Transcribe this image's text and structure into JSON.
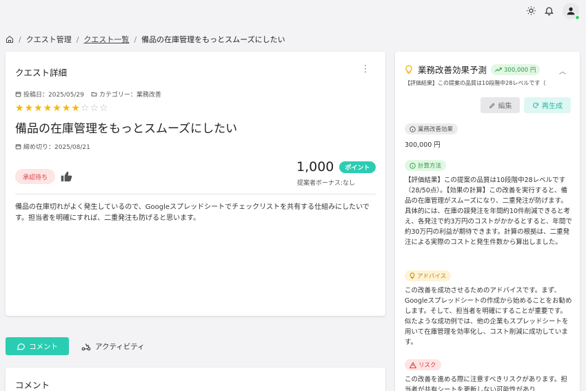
{
  "topbar": {
    "icons": [
      "sun-icon",
      "bell-icon",
      "user-icon"
    ]
  },
  "breadcrumb": {
    "items": [
      "クエスト管理",
      "クエスト一覧",
      "備品の在庫管理をもっとスムーズにしたい"
    ]
  },
  "detail": {
    "card_title": "クエスト詳細",
    "posted_date": "投稿日：2025/05/29",
    "category": "カテゴリー：業務改善",
    "rating": {
      "value": 7,
      "max": 10
    },
    "quest_title": "備品の在庫管理をもっとスムーズにしたい",
    "deadline": "締め切り：2025/08/21",
    "status": "承認待ち",
    "points": "1,000",
    "points_badge": "ポイント",
    "bonus": "提案者ボーナス:なし",
    "description": "備品の在庫切れがよく発生しているので、Googleスプレッドシートでチェックリストを共有する仕組みにしたいです。担当者を明確にすれば、二重発注も防げると思います。"
  },
  "tabs": {
    "comment": "コメント",
    "activity": "アクティビティ"
  },
  "comment_section": {
    "title": "コメント"
  },
  "effect": {
    "title": "業務改善効果予測",
    "amount_badge": "300,000 円",
    "summary": "【評価結果】この提案の品質は10段階中28レベルです（",
    "edit_label": "編集",
    "regen_label": "再生成",
    "effect_chip": "業務改善効果",
    "effect_value": "300,000 円",
    "calc_chip": "計算方法",
    "calc_text": "【評価結果】この提案の品質は10段階中28レベルです（28/50点）。【効果の計算】この改善を実行すると、備品の在庫管理がスムーズになり、二重発注が防げます。具体的には、在庫の誤発注を年間約10件削減できると考え、各発注で約3万円のコストがかかるとすると、年間で約30万円の利益が期待できます。計算の根拠は、二重発注による実際のコストと発生件数から算出しました。",
    "advice_chip": "アドバイス",
    "advice_text": "この改善を成功させるためのアドバイスです。まず、Googleスプレッドシートの作成から始めることをお勧めします。そして、担当者を明確にすることが重要です。似たような成功例では、他の企業もスプレッドシートを用いて在庫管理を効率化し、コスト削減に成功しています。",
    "risk_chip": "リスク",
    "risk_text": "この改善を進める際に注意すべきリスクがあります。担当者が共有シートを更新しない可能性があり"
  },
  "colors": {
    "accent": "#2bcdb2",
    "star": "#f5b800",
    "status_red": "#e04444"
  }
}
